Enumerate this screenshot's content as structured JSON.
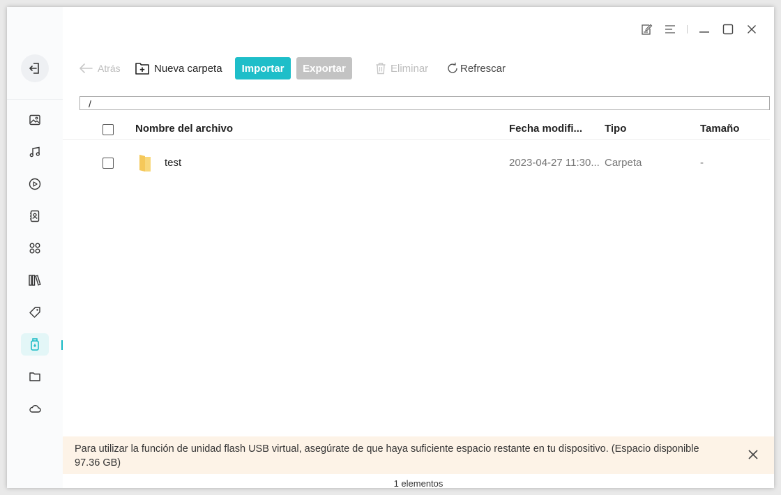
{
  "colors": {
    "accent": "#1ebec9",
    "banner_bg": "#fdf3e7",
    "folder": "#f5c85a"
  },
  "sidebar": {
    "back_icon": "exit-back-icon",
    "items": [
      {
        "name": "photos",
        "icon": "image-icon"
      },
      {
        "name": "music",
        "icon": "music-note-icon"
      },
      {
        "name": "videos",
        "icon": "play-circle-icon"
      },
      {
        "name": "contacts",
        "icon": "contacts-book-icon"
      },
      {
        "name": "apps",
        "icon": "command-icon"
      },
      {
        "name": "books",
        "icon": "books-icon"
      },
      {
        "name": "ringtones",
        "icon": "tag-icon"
      },
      {
        "name": "usb-flash",
        "icon": "usb-drive-icon",
        "active": true
      },
      {
        "name": "files",
        "icon": "folder-icon"
      },
      {
        "name": "cloud",
        "icon": "cloud-icon"
      }
    ]
  },
  "toolbar": {
    "back_label": "Atrás",
    "new_folder_label": "Nueva carpeta",
    "import_label": "Importar",
    "export_label": "Exportar",
    "delete_label": "Eliminar",
    "refresh_label": "Refrescar"
  },
  "path": {
    "value": "/"
  },
  "table": {
    "columns": [
      "Nombre del archivo",
      "Fecha modifi...",
      "Tipo",
      "Tamaño"
    ],
    "rows": [
      {
        "name": "test",
        "date": "2023-04-27 11:30...",
        "type": "Carpeta",
        "size": "-"
      }
    ]
  },
  "banner": {
    "text": "Para utilizar la función de unidad flash USB virtual, asegúrate de que haya suficiente espacio restante en tu dispositivo. (Espacio disponible 97.36 GB)"
  },
  "status": {
    "count_text": "1 elementos"
  }
}
